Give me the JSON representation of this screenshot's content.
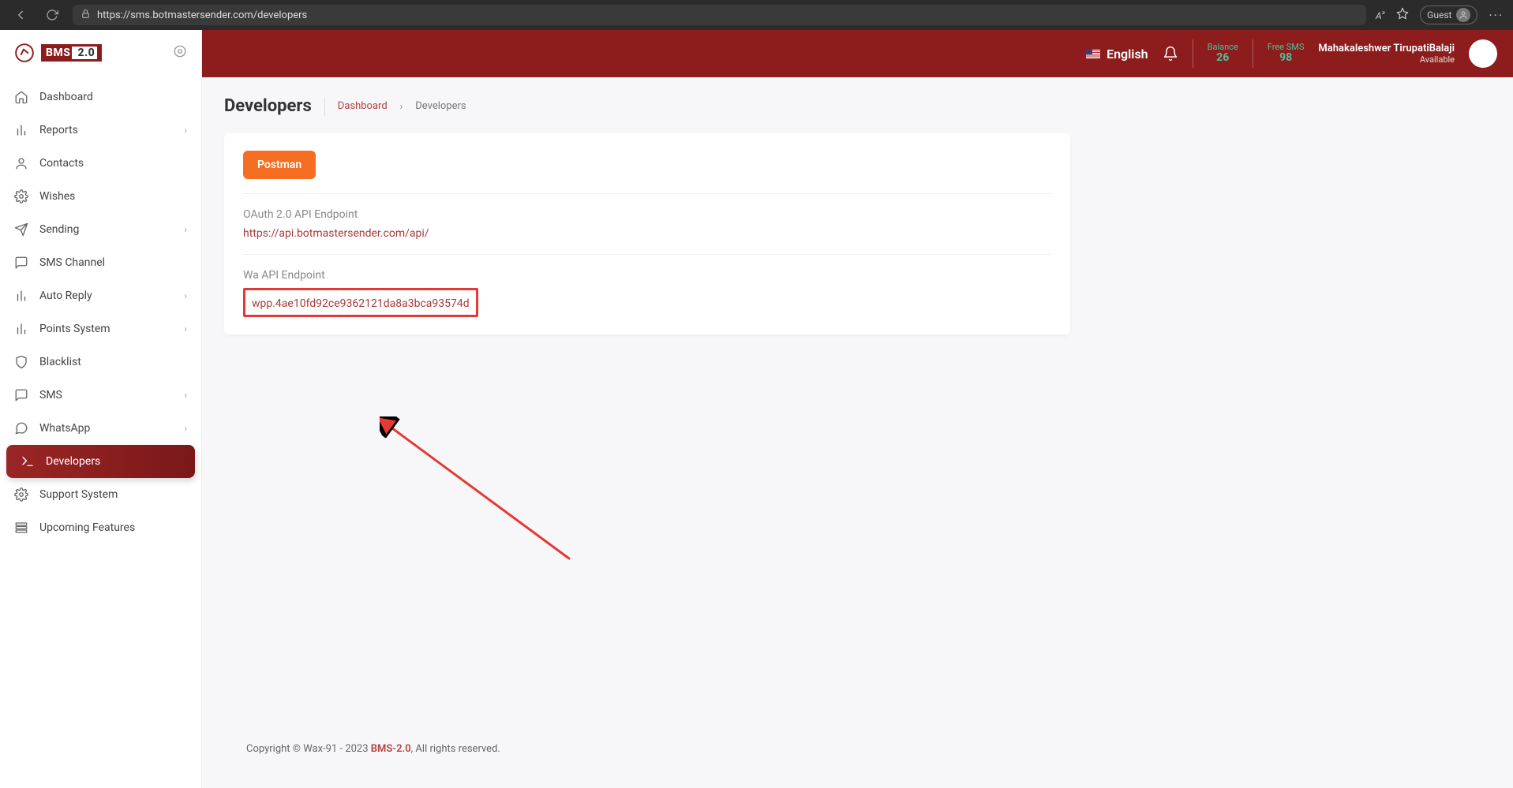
{
  "browser": {
    "url": "https://sms.botmastersender.com/developers",
    "guest_label": "Guest"
  },
  "logo": {
    "text_left": "BMS",
    "text_right": " 2.0"
  },
  "sidebar": {
    "items": [
      {
        "label": "Dashboard",
        "icon": "home",
        "expandable": false
      },
      {
        "label": "Reports",
        "icon": "bars",
        "expandable": true
      },
      {
        "label": "Contacts",
        "icon": "person",
        "expandable": false
      },
      {
        "label": "Wishes",
        "icon": "gear",
        "expandable": false
      },
      {
        "label": "Sending",
        "icon": "send",
        "expandable": true
      },
      {
        "label": "SMS Channel",
        "icon": "chat",
        "expandable": false
      },
      {
        "label": "Auto Reply",
        "icon": "bars",
        "expandable": true
      },
      {
        "label": "Points System",
        "icon": "bars",
        "expandable": true
      },
      {
        "label": "Blacklist",
        "icon": "shield",
        "expandable": false
      },
      {
        "label": "SMS",
        "icon": "chat",
        "expandable": true
      },
      {
        "label": "WhatsApp",
        "icon": "chat-round",
        "expandable": true
      },
      {
        "label": "Developers",
        "icon": "terminal",
        "expandable": false,
        "active": true
      },
      {
        "label": "Support System",
        "icon": "gear",
        "expandable": false
      },
      {
        "label": "Upcoming Features",
        "icon": "layers",
        "expandable": false
      }
    ]
  },
  "topbar": {
    "language": "English",
    "balance_label": "Balance",
    "balance_value": "26",
    "freesms_label": "Free SMS",
    "freesms_value": "98",
    "user_name": "Mahakaleshwer TirupatiBalaji",
    "user_status": "Available"
  },
  "page": {
    "title": "Developers",
    "breadcrumb_root": "Dashboard",
    "breadcrumb_current": "Developers",
    "postman_button": "Postman",
    "oauth_label": "OAuth 2.0 API Endpoint",
    "oauth_value": "https://api.botmastersender.com/api/",
    "wa_label": "Wa API Endpoint",
    "wa_value": "wpp.4ae10fd92ce9362121da8a3bca93574d"
  },
  "footer": {
    "prefix": "Copyright © Wax-91 - 2023  ",
    "brand": "BMS-2.0",
    "suffix": ", All rights reserved."
  }
}
